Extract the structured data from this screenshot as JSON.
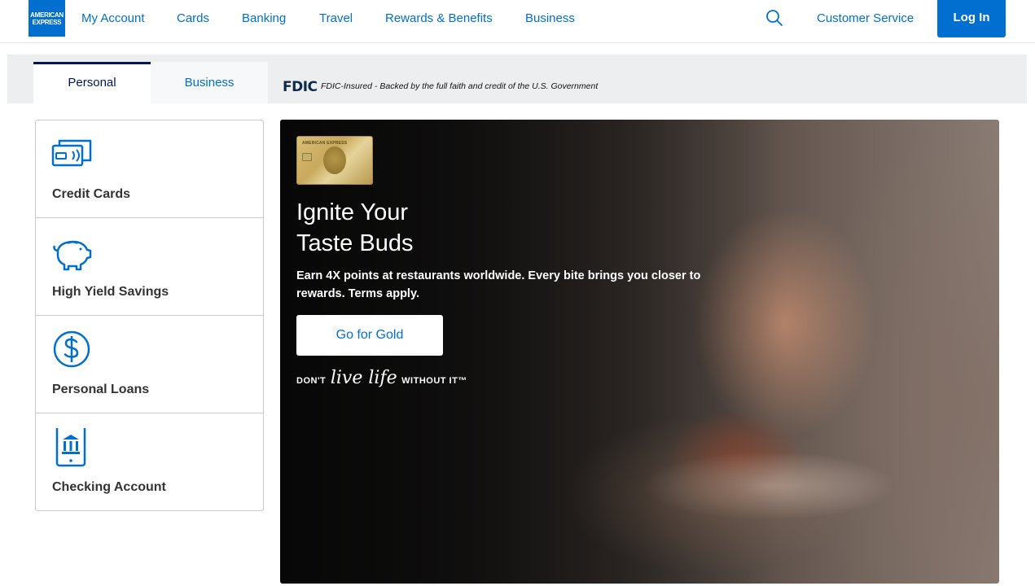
{
  "brand": {
    "logo_line1": "AMERICAN",
    "logo_line2": "EXPRESS"
  },
  "topnav": {
    "items": [
      "My Account",
      "Cards",
      "Banking",
      "Travel",
      "Rewards & Benefits",
      "Business"
    ],
    "customer_service": "Customer Service",
    "login": "Log In",
    "search_icon": "search-icon"
  },
  "tabs": {
    "personal": "Personal",
    "business": "Business",
    "active": "Personal"
  },
  "fdic": {
    "logo": "FDIC",
    "text": "FDIC-Insured - Backed by the full faith and credit of the U.S. Government"
  },
  "products": [
    {
      "label": "Credit Cards",
      "icon": "credit-cards-icon"
    },
    {
      "label": "High Yield Savings",
      "icon": "piggy-bank-icon"
    },
    {
      "label": "Personal Loans",
      "icon": "dollar-circle-icon"
    },
    {
      "label": "Checking Account",
      "icon": "mobile-bank-icon"
    }
  ],
  "hero": {
    "card_brand": "AMERICAN EXPRESS",
    "title_line1": "Ignite Your",
    "title_line2": "Taste Buds",
    "subtitle": "Earn 4X points at restaurants worldwide. Every bite brings you closer to rewards. Terms apply.",
    "cta": "Go for Gold",
    "tagline_start": "DON'T",
    "tagline_script": "live life",
    "tagline_end": "WITHOUT IT™"
  },
  "colors": {
    "accent": "#016fd0",
    "navy": "#00175a",
    "tab_bar": "#eceef0"
  }
}
